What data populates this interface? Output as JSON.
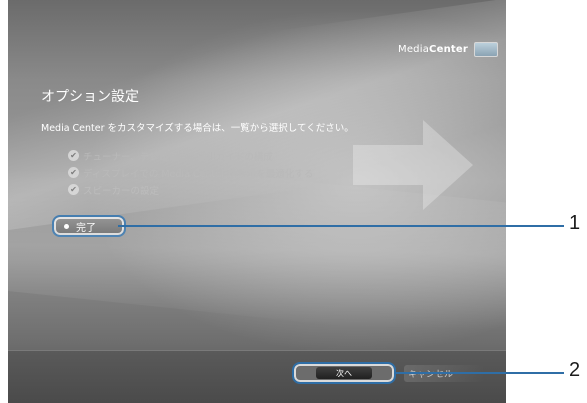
{
  "logo": {
    "prefix": "Media",
    "suffix": "Center"
  },
  "page": {
    "title": "オプション設定",
    "subtitle": "Media Center をカスタマイズする場合は、一覧から選択してください。"
  },
  "options": [
    {
      "label": "チューナー、テレビ信号、番組ガイドの構成",
      "checked": true
    },
    {
      "label": "ディスプレイでの Media Center の表示を最適化する",
      "checked": true
    },
    {
      "label": "スピーカーの設定",
      "checked": true
    }
  ],
  "done": {
    "label": "完了"
  },
  "footer": {
    "next_label": "次へ",
    "cancel_label": "キャンセル"
  },
  "callouts": {
    "one": "1",
    "two": "2"
  },
  "colors": {
    "highlight": "#2f6ea6",
    "text": "#ffffff",
    "dimmed_text": "#b9b9b9"
  }
}
